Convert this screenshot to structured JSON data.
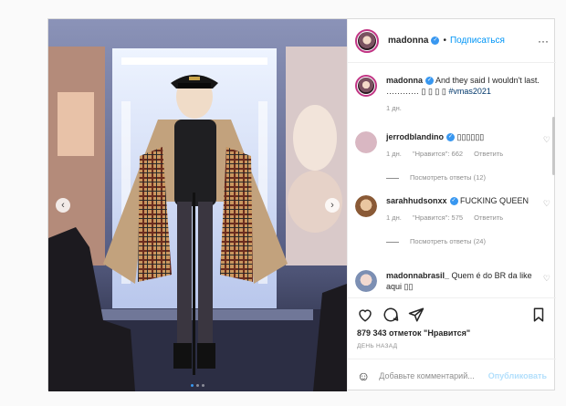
{
  "post": {
    "author": "madonna",
    "follow_label": "Подписаться",
    "separator": "•",
    "more_label": "···",
    "caption": {
      "username": "madonna",
      "text": "And they said I wouldn't last. ………… ▯ ▯ ▯ ▯",
      "hashtag": "#vmas2021",
      "age": "1 дн."
    },
    "comments": [
      {
        "username": "jerrodblandino",
        "text": "▯▯▯▯▯▯",
        "age": "1 дн.",
        "likes": "\"Нравится\": 662",
        "reply_label": "Ответить",
        "view_replies": "Посмотреть ответы (12)",
        "verified": true,
        "avatar_color": "#d9b7c2"
      },
      {
        "username": "sarahhudsonxx",
        "text": "FUCKING QUEEN",
        "age": "1 дн.",
        "likes": "\"Нравится\": 575",
        "reply_label": "Ответить",
        "view_replies": "Посмотреть ответы (24)",
        "verified": true,
        "avatar_color": "#c58a5a"
      },
      {
        "username": "madonnabrasil_",
        "text": "Quem é do BR da like aqui ▯▯",
        "verified": false,
        "avatar_color": "#7c8fb3"
      }
    ],
    "likes_text": "879 343 отметок \"Нравится\"",
    "date_text": "ДЕНЬ НАЗАД",
    "add_comment_placeholder": "Добавьте комментарий...",
    "publish_label": "Опубликовать",
    "carousel": {
      "prev": "‹",
      "next": "›",
      "slide_count": 3,
      "active_slide": 1
    },
    "icons": {
      "like": "heart-icon",
      "comment": "comment-bubble-icon",
      "share": "paper-plane-icon",
      "save": "bookmark-icon",
      "verified": "verified-badge-icon",
      "emoji": "smiley-icon"
    },
    "colors": {
      "link": "#0095f6",
      "verified": "#3897f0",
      "muted": "#8e8e8e",
      "publish_disabled": "#b2dffc"
    }
  }
}
